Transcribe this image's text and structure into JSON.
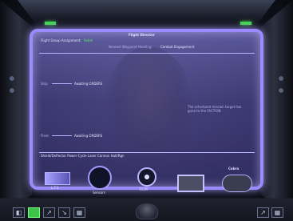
{
  "window": {
    "title": "Flight Director"
  },
  "mission": {
    "assignment_label": "Flight Group Assignment:",
    "assignment_value": "Rebel",
    "waypoint_label": "Nearest Waypoint Heading:",
    "waypoint_value": "Combat Engagement"
  },
  "rows": [
    {
      "side": "Ship",
      "status": "Awaiting ORDERS"
    },
    {
      "side": "Fleet",
      "status": "Awaiting ORDERS"
    }
  ],
  "info_text": "The scheduled mission target has gone to the FACTION",
  "bottom_status": "Shield/Deflector  Power Cycle  Laser Cannon  Hull/Rgn",
  "indicators": [
    {
      "name": "shield-gauge",
      "label": "L.T.S"
    },
    {
      "name": "radar-gauge",
      "label": "Sensors"
    },
    {
      "name": "targeting-display",
      "label": "T.C.M"
    },
    {
      "name": "ship-display",
      "label": "Cobra"
    }
  ],
  "colors": {
    "panel": "#9b8bff",
    "accent_green": "#58e36a"
  }
}
